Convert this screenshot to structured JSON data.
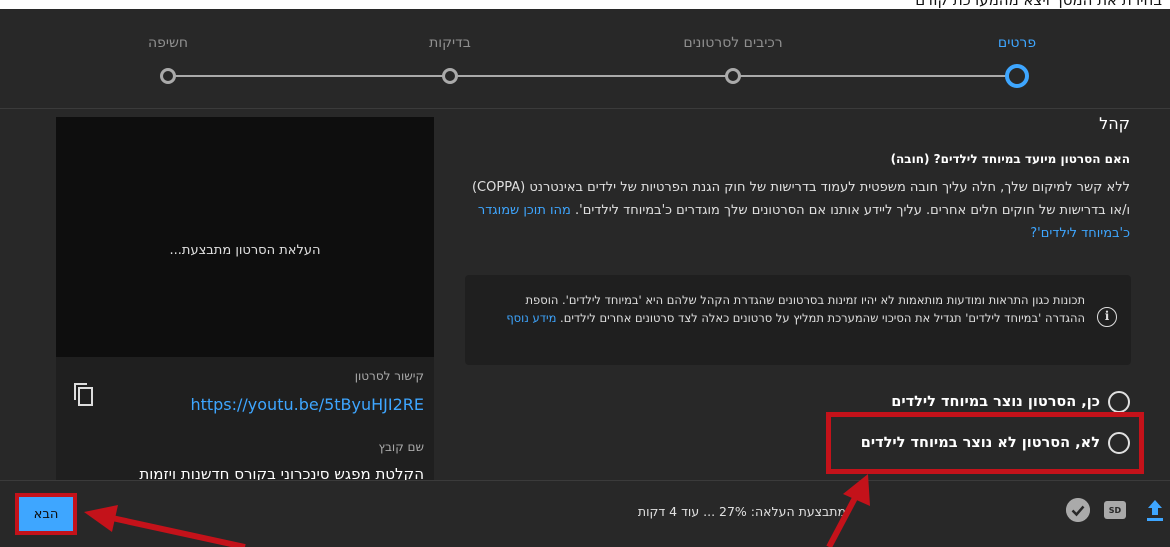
{
  "top_caption": "בחירת את המסך ויצא מהמערכת קודם",
  "stepper": {
    "steps": [
      {
        "label": "פרטים",
        "active": true
      },
      {
        "label": "רכיבים לסרטונים",
        "active": false
      },
      {
        "label": "בדיקות",
        "active": false
      },
      {
        "label": "חשיפה",
        "active": false
      }
    ]
  },
  "audience": {
    "title": "קהל",
    "question": "האם הסרטון מיועד במיוחד לילדים? (חובה)",
    "description": "ללא קשר למיקום שלך, חלה עליך חובה משפטית לעמוד בדרישות של חוק הגנת הפרטיות של ילדים באינטרנט (COPPA) ו/או בדרישות של חוקים חלים אחרים. עליך ליידע אותנו אם הסרטונים שלך מוגדרים כ'במיוחד לילדים'.",
    "description_link": "מהו תוכן שמוגדר כ'במיוחד לילדים'?",
    "info_text": "תכונות כגון התראות ומודעות מותאמות לא יהיו זמינות בסרטונים שהגדרת הקהל שלהם היא 'במיוחד לילדים'. הוספת ההגדרה 'במיוחד לילדים' תגדיל את הסיכוי שהמערכת תמליץ על סרטונים כאלה לצד סרטונים אחרים לילדים.",
    "info_link": "מידע נוסף",
    "options": [
      {
        "label": "כן, הסרטון נוצר במיוחד לילדים"
      },
      {
        "label": "לא, הסרטון לא נוצר במיוחד לילדים"
      }
    ]
  },
  "preview": {
    "processing_text": "העלאת הסרטון מתבצעת...",
    "link_label": "קישור לסרטון",
    "link_url": "https://youtu.be/5tByuHJI2RE",
    "file_label": "שם קובץ",
    "file_name": "הקלטת מפגש סינכרוני בקורס חדשנות ויזמות"
  },
  "footer": {
    "status": "מתבצעת העלאה: 27% ... עוד 4 דקות",
    "next_label": "הבא",
    "sd_badge": "SD"
  },
  "colors": {
    "accent": "#3ea6ff",
    "annotation_red": "#c4121a",
    "background": "#282828"
  }
}
